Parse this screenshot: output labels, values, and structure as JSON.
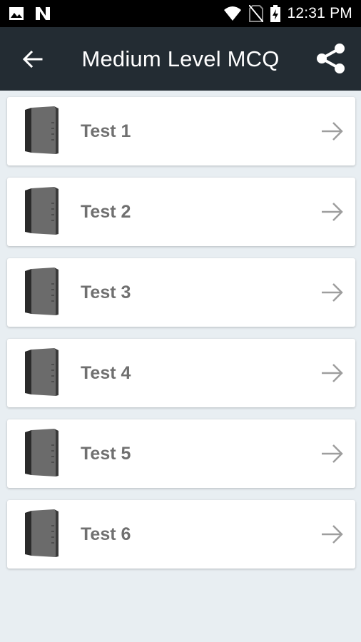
{
  "status_bar": {
    "time": "12:31 PM",
    "icons": [
      "image-icon",
      "n-notification-icon",
      "wifi-icon",
      "no-sim-icon",
      "battery-charging-icon"
    ]
  },
  "app_bar": {
    "title": "Medium Level MCQ",
    "back_icon": "arrow-left-icon",
    "share_icon": "share-icon",
    "background": "#232c33"
  },
  "tests": [
    {
      "label": "Test 1"
    },
    {
      "label": "Test 2"
    },
    {
      "label": "Test 3"
    },
    {
      "label": "Test 4"
    },
    {
      "label": "Test 5"
    },
    {
      "label": "Test 6"
    }
  ],
  "colors": {
    "page_background": "#e8eef2",
    "card_background": "#ffffff",
    "label_text": "#707070",
    "arrow": "#9e9e9e"
  }
}
